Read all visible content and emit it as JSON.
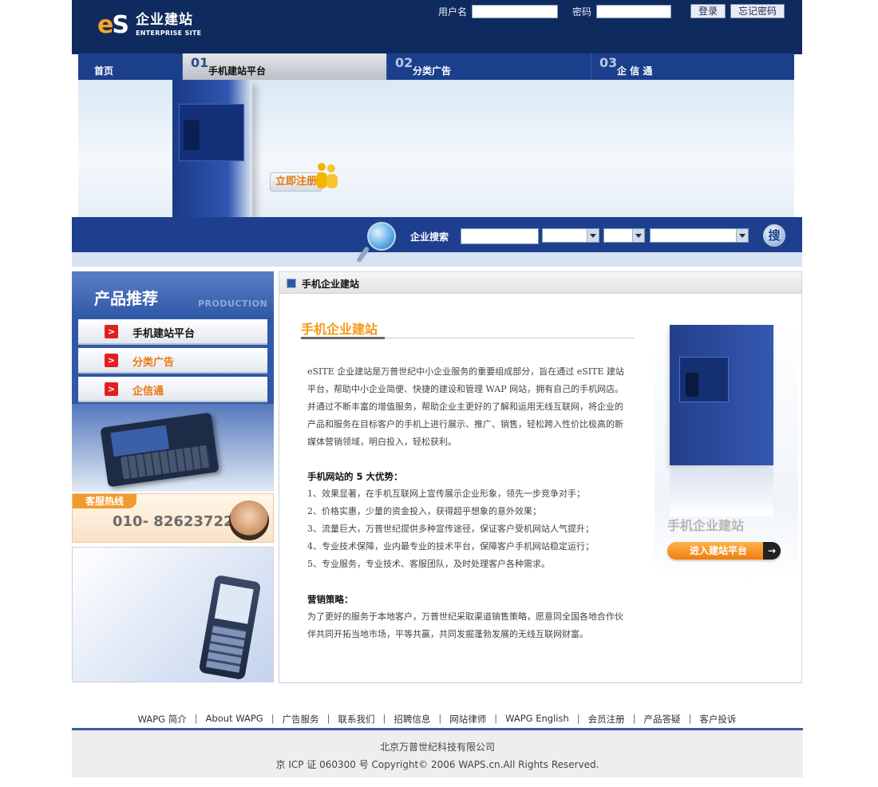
{
  "logo": {
    "mark_e": "e",
    "mark_s": "S",
    "cn": "企业建站",
    "en": "ENTERPRISE SITE"
  },
  "login": {
    "username_label": "用户名",
    "password_label": "密码",
    "username_value": "",
    "password_value": "",
    "login_button": "登录",
    "forgot_button": "忘记密码"
  },
  "nav": {
    "home": "首页",
    "items": [
      {
        "num": "01",
        "label": "手机建站平台"
      },
      {
        "num": "02",
        "label": "分类广告"
      },
      {
        "num": "03",
        "label": "企 信 通"
      }
    ]
  },
  "banner": {
    "register_button": "立即注册"
  },
  "search": {
    "label": "企业搜索",
    "keyword_value": "",
    "go_label": "搜"
  },
  "sidebar": {
    "title": "产品推荐",
    "subtitle": "PRODUCTION",
    "items": [
      {
        "label": "手机建站平台",
        "color": "#111111"
      },
      {
        "label": "分类广告",
        "color": "#e8780c"
      },
      {
        "label": "企信通",
        "color": "#e8780c"
      }
    ],
    "hotline_tag": "客服热线",
    "hotline_number": "010- 82623722"
  },
  "content": {
    "header": "手机企业建站",
    "title": "手机企业建站",
    "intro": "eSITE 企业建站是万普世纪中小企业服务的重要组成部分，旨在通过 eSITE 建站平台，帮助中小企业简便、快捷的建设和管理 WAP 网站，拥有自己的手机网店。并通过不断丰富的增值服务，帮助企业主更好的了解和运用无线互联网，将企业的产品和服务在目标客户的手机上进行展示、推广、销售，轻松跨入性价比极高的新媒体营销领域，明白投入，轻松获利。",
    "advantages_title": "手机网站的 5 大优势：",
    "advantages": [
      "1、效果显著，在手机互联网上宣传展示企业形象，领先一步竞争对手；",
      "2、价格实惠，少量的资金投入，获得超乎想象的意外效果；",
      "3、流量巨大，万普世纪提供多种宣传途径，保证客户受机网站人气提升；",
      "4、专业技术保障，业内最专业的技术平台，保障客户手机网站稳定运行；",
      "5、专业服务，专业技术、客服团队，及时处理客户各种需求。"
    ],
    "strategy_title": "营销策略：",
    "strategy": "为了更好的服务于本地客户，万普世纪采取渠道销售策略，愿意同全国各地合作伙伴共同开拓当地市场，平等共赢，共同发掘蓬勃发展的无线互联网财富。",
    "visual_caption": "手机企业建站",
    "enter_button": "进入建站平台",
    "enter_arrow": "→"
  },
  "footer": {
    "links": [
      "WAPG 简介",
      "About WAPG",
      "广告服务",
      "联系我们",
      "招聘信息",
      "网站律师",
      "WAPG English",
      "会员注册",
      "产品答疑",
      "客户投诉"
    ],
    "separator": "|",
    "company": "北京万普世纪科技有限公司",
    "copyright": "京 ICP 证 060300 号 Copyright© 2006 WAPS.cn.All Rights Reserved."
  },
  "colors": {
    "header_bg": "#0f2a5e",
    "accent_orange": "#f39a16",
    "nav_bg": "#1b3f8a"
  }
}
